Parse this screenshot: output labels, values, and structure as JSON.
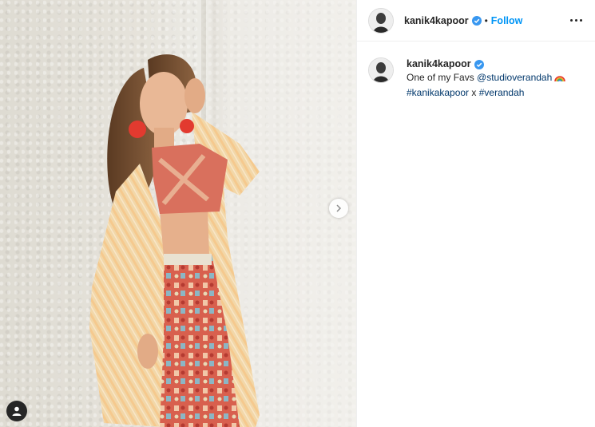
{
  "post": {
    "username": "kanik4kapoor",
    "follow_label": "Follow",
    "separator": "•"
  },
  "caption": {
    "username": "kanik4kapoor",
    "text_before": "One of my Favs ",
    "mention": "@studioverandah",
    "emoji": "rainbow",
    "hashtag1": "#kanikakapoor",
    "joiner": " x ",
    "hashtag2": "#verandah"
  },
  "colors": {
    "accent": "#0095f6",
    "link": "#00376b",
    "text": "#262626",
    "divider": "#efefef"
  },
  "icons": [
    "verified-badge-icon",
    "more-options-icon",
    "next-arrow-icon",
    "user-tag-icon",
    "rainbow-emoji-icon"
  ]
}
